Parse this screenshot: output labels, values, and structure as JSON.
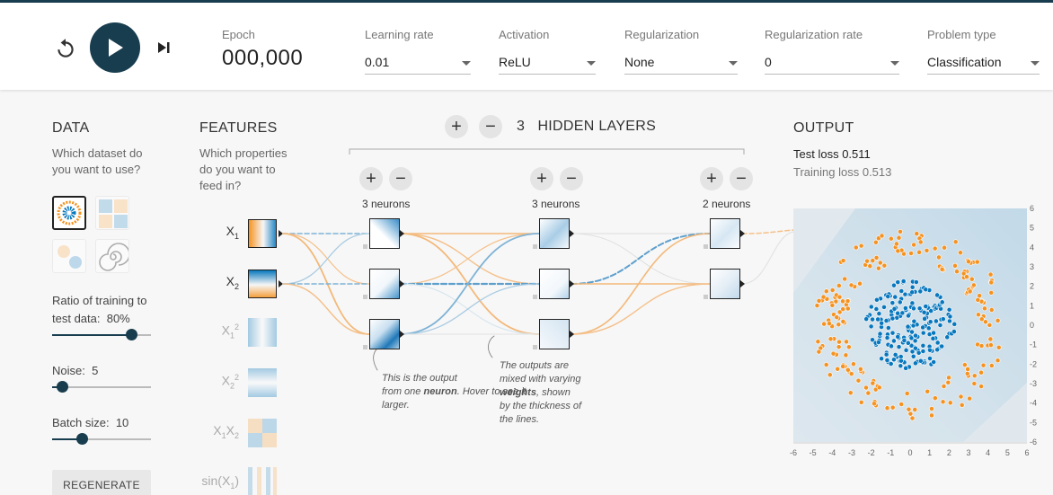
{
  "controls": {
    "epoch_label": "Epoch",
    "epoch_value": "000,000",
    "learning_rate": {
      "label": "Learning rate",
      "value": "0.01"
    },
    "activation": {
      "label": "Activation",
      "value": "ReLU"
    },
    "regularization": {
      "label": "Regularization",
      "value": "None"
    },
    "regularization_rate": {
      "label": "Regularization rate",
      "value": "0"
    },
    "problem_type": {
      "label": "Problem type",
      "value": "Classification"
    }
  },
  "data": {
    "heading": "DATA",
    "question_line1": "Which dataset do",
    "question_line2": "you want to use?",
    "ratio_label": "Ratio of training to",
    "ratio_label2": "test data:",
    "ratio_value": "80%",
    "ratio_fraction": 0.8,
    "noise_label": "Noise:",
    "noise_value": "5",
    "noise_fraction": 0.1,
    "batch_label": "Batch size:",
    "batch_value": "10",
    "batch_fraction": 0.3,
    "regenerate_label": "REGENERATE"
  },
  "features": {
    "heading": "FEATURES",
    "question_line1": "Which properties",
    "question_line2": "do you want to",
    "question_line3": "feed in?",
    "items": [
      {
        "base": "X",
        "sub": "1",
        "sup": "",
        "active": true
      },
      {
        "base": "X",
        "sub": "2",
        "sup": "",
        "active": true
      },
      {
        "base": "X",
        "sub": "1",
        "sup": "2",
        "active": false
      },
      {
        "base": "X",
        "sub": "2",
        "sup": "2",
        "active": false
      },
      {
        "base": "X",
        "sub": "1",
        "sup": "",
        "base2": "X",
        "sub2": "2",
        "active": false
      },
      {
        "base": "sin(X",
        "sub": "1",
        "tail": ")",
        "active": false
      }
    ]
  },
  "network": {
    "plus": "+",
    "minus": "−",
    "layer_count": "3",
    "layers_label": "HIDDEN LAYERS",
    "layers": [
      {
        "label": "3 neurons"
      },
      {
        "label": "3 neurons"
      },
      {
        "label": "2 neurons"
      }
    ],
    "note1": [
      "This is the output",
      "from one ",
      "neuron",
      ". Hover to see it",
      "larger."
    ],
    "note2": [
      "The outputs are",
      "mixed with varying",
      "weights",
      ", shown",
      "by the thickness of",
      "the lines."
    ]
  },
  "output": {
    "heading": "OUTPUT",
    "test_loss_label": "Test loss",
    "test_loss_value": "0.511",
    "train_loss_label": "Training loss",
    "train_loss_value": "0.513",
    "x_ticks": [
      "-6",
      "-5",
      "-4",
      "-3",
      "-2",
      "-1",
      "0",
      "1",
      "2",
      "3",
      "4",
      "5",
      "6"
    ],
    "y_ticks": [
      "6",
      "5",
      "4",
      "3",
      "2",
      "1",
      "0",
      "-1",
      "-2",
      "-3",
      "-4",
      "-5",
      "-6"
    ]
  },
  "colors": {
    "dark": "#183d4e",
    "blue": "#0877bd",
    "orange": "#f59322",
    "light_blue": "#c5dbe8"
  }
}
